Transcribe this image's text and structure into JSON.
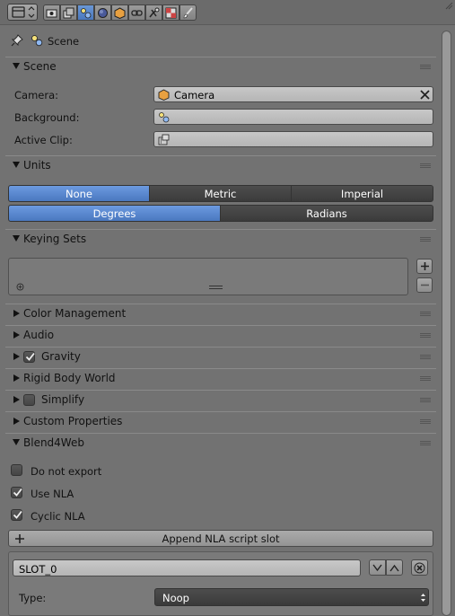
{
  "header": {
    "editor_menu_icon": "editor-type-icon",
    "context_icons": [
      "render-icon",
      "render-layers-icon",
      "scene-icon",
      "world-icon",
      "object-icon",
      "constraints-icon",
      "modifiers-icon",
      "texture-icon",
      "brush-icon"
    ],
    "active_context": "scene-icon"
  },
  "breadcrumb": {
    "label": "Scene",
    "pin_icon": "pin-icon"
  },
  "scene_panel": {
    "title": "Scene",
    "camera_label": "Camera:",
    "camera_value": "Camera",
    "background_label": "Background:",
    "background_value": "",
    "active_clip_label": "Active Clip:",
    "active_clip_value": ""
  },
  "units_panel": {
    "title": "Units",
    "systems": [
      "None",
      "Metric",
      "Imperial"
    ],
    "selected_system": "None",
    "rotation": [
      "Degrees",
      "Radians"
    ],
    "selected_rotation": "Degrees"
  },
  "keying_sets_panel": {
    "title": "Keying Sets"
  },
  "collapsed_panels": [
    {
      "title": "Color Management",
      "checkbox": null
    },
    {
      "title": "Audio",
      "checkbox": null
    },
    {
      "title": "Gravity",
      "checkbox": true
    },
    {
      "title": "Rigid Body World",
      "checkbox": null
    },
    {
      "title": "Simplify",
      "checkbox": false
    },
    {
      "title": "Custom Properties",
      "checkbox": null
    }
  ],
  "blend4web_panel": {
    "title": "Blend4Web",
    "do_not_export_label": "Do not export",
    "do_not_export": false,
    "use_nla_label": "Use NLA",
    "use_nla": true,
    "cyclic_nla_label": "Cyclic NLA",
    "cyclic_nla": true,
    "append_slot_label": "Append NLA script slot",
    "slot_name": "SLOT_0",
    "type_label": "Type:",
    "type_value": "Noop"
  }
}
